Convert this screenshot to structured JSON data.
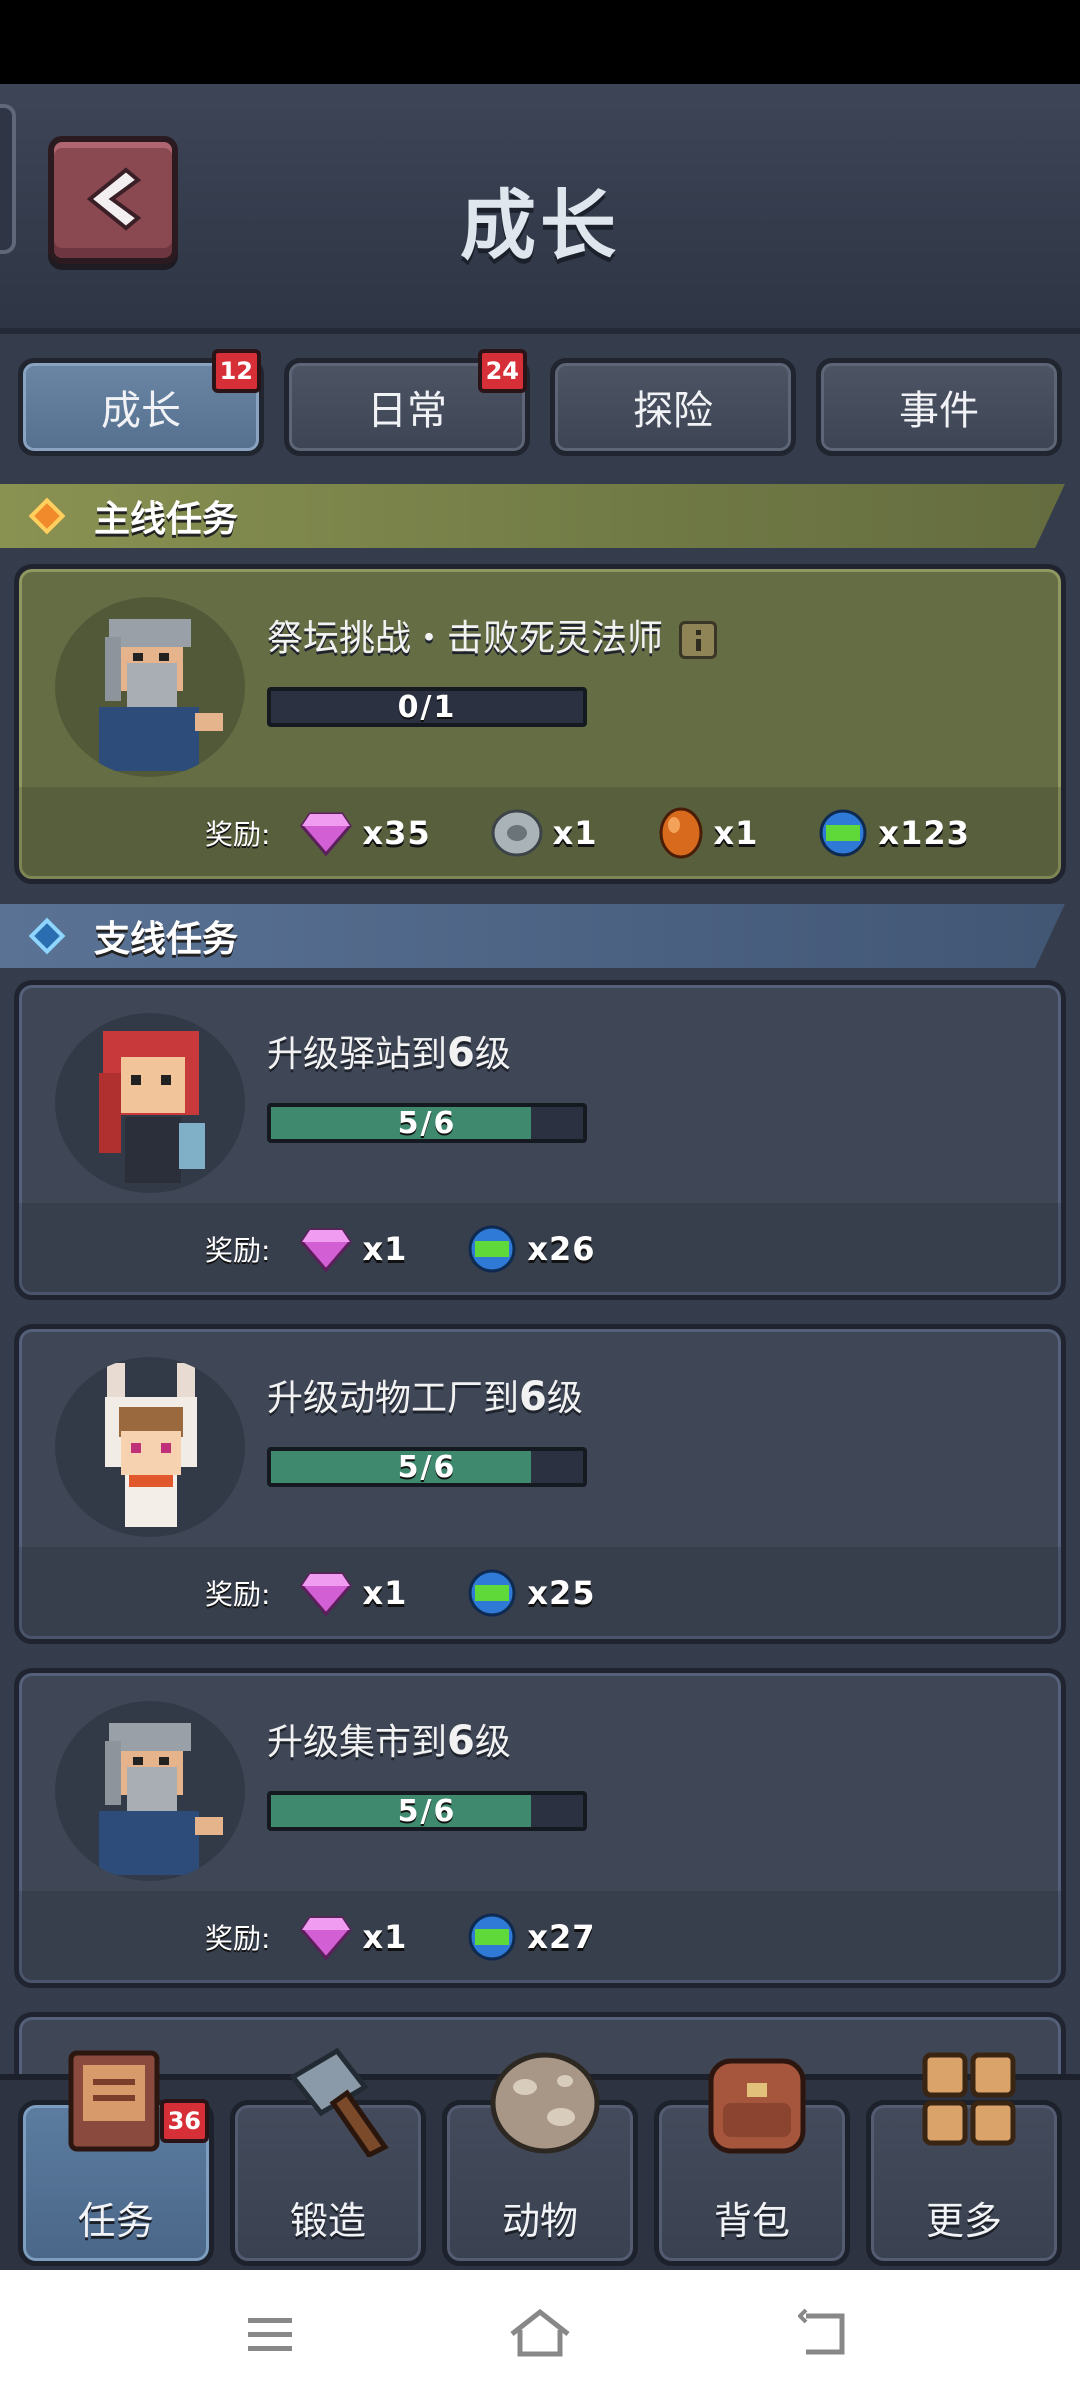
{
  "header": {
    "title": "成长"
  },
  "tabs": [
    {
      "label": "成长",
      "badge": "12",
      "active": true
    },
    {
      "label": "日常",
      "badge": "24",
      "active": false
    },
    {
      "label": "探险",
      "badge": "",
      "active": false
    },
    {
      "label": "事件",
      "badge": "",
      "active": false
    }
  ],
  "sections": {
    "main": "主线任务",
    "side": "支线任务"
  },
  "main_quest": {
    "title": "祭坛挑战・击败死灵法师",
    "progress_text": "0/1",
    "progress": 0.0,
    "reward_label": "奖励:",
    "rewards": [
      {
        "icon": "gem-icon",
        "qty": "x35"
      },
      {
        "icon": "stone-ring-icon",
        "qty": "x1"
      },
      {
        "icon": "amber-orb-icon",
        "qty": "x1"
      },
      {
        "icon": "exp-orb-icon",
        "qty": "x123"
      }
    ]
  },
  "side_quests": [
    {
      "title_prefix": "升级驿站到",
      "level": "6",
      "title_suffix": "级",
      "progress_text": "5/6",
      "progress": 0.833,
      "reward_label": "奖励:",
      "rewards": [
        {
          "icon": "gem-icon",
          "qty": "x1"
        },
        {
          "icon": "exp-orb-icon",
          "qty": "x26"
        }
      ]
    },
    {
      "title_prefix": "升级动物工厂到",
      "level": "6",
      "title_suffix": "级",
      "progress_text": "5/6",
      "progress": 0.833,
      "reward_label": "奖励:",
      "rewards": [
        {
          "icon": "gem-icon",
          "qty": "x1"
        },
        {
          "icon": "exp-orb-icon",
          "qty": "x25"
        }
      ]
    },
    {
      "title_prefix": "升级集市到",
      "level": "6",
      "title_suffix": "级",
      "progress_text": "5/6",
      "progress": 0.833,
      "reward_label": "奖励:",
      "rewards": [
        {
          "icon": "gem-icon",
          "qty": "x1"
        },
        {
          "icon": "exp-orb-icon",
          "qty": "x27"
        }
      ]
    }
  ],
  "bottom_nav": [
    {
      "label": "任务",
      "badge": "36",
      "active": true,
      "icon": "quest-book-icon"
    },
    {
      "label": "锻造",
      "badge": "",
      "active": false,
      "icon": "hammer-icon"
    },
    {
      "label": "动物",
      "badge": "",
      "active": false,
      "icon": "egg-icon"
    },
    {
      "label": "背包",
      "badge": "",
      "active": false,
      "icon": "backpack-icon"
    },
    {
      "label": "更多",
      "badge": "",
      "active": false,
      "icon": "grid-icon"
    }
  ],
  "colors": {
    "progress_fill": "#3f8a6f",
    "badge": "#d62f37",
    "main_section": "#707a45",
    "side_section": "#4b6182"
  }
}
